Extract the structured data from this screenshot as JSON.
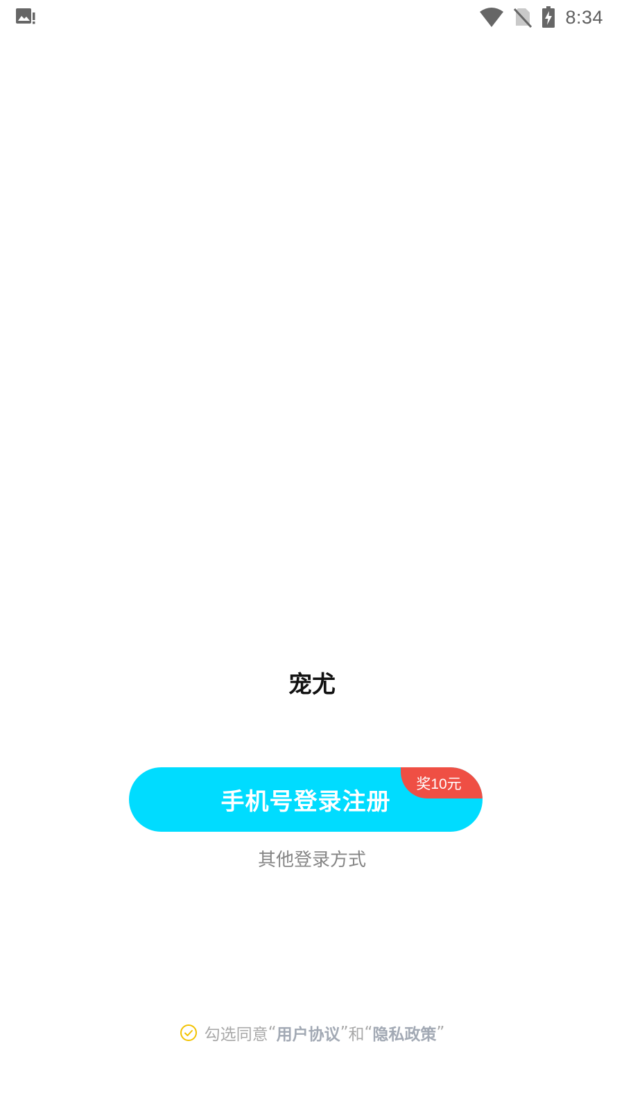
{
  "status_bar": {
    "time": "8:34",
    "icons": [
      "image-alert-icon",
      "wifi-icon",
      "no-sim-icon",
      "battery-charging-icon"
    ]
  },
  "app": {
    "title": "宠尤"
  },
  "login": {
    "primary_label": "手机号登录注册",
    "reward_badge": "奖10元",
    "other_label": "其他登录方式"
  },
  "agreement": {
    "prefix": "勾选同意",
    "quote_open_1": "“",
    "user_agreement": "用户协议",
    "quote_close_1": "”",
    "conjunction": "和",
    "quote_open_2": "“",
    "privacy_policy": "隐私政策",
    "quote_close_2": "”"
  },
  "colors": {
    "primary_button": "#00dcff",
    "badge": "#ef4f44",
    "check": "#f2c200",
    "secondary_text": "#858585"
  }
}
